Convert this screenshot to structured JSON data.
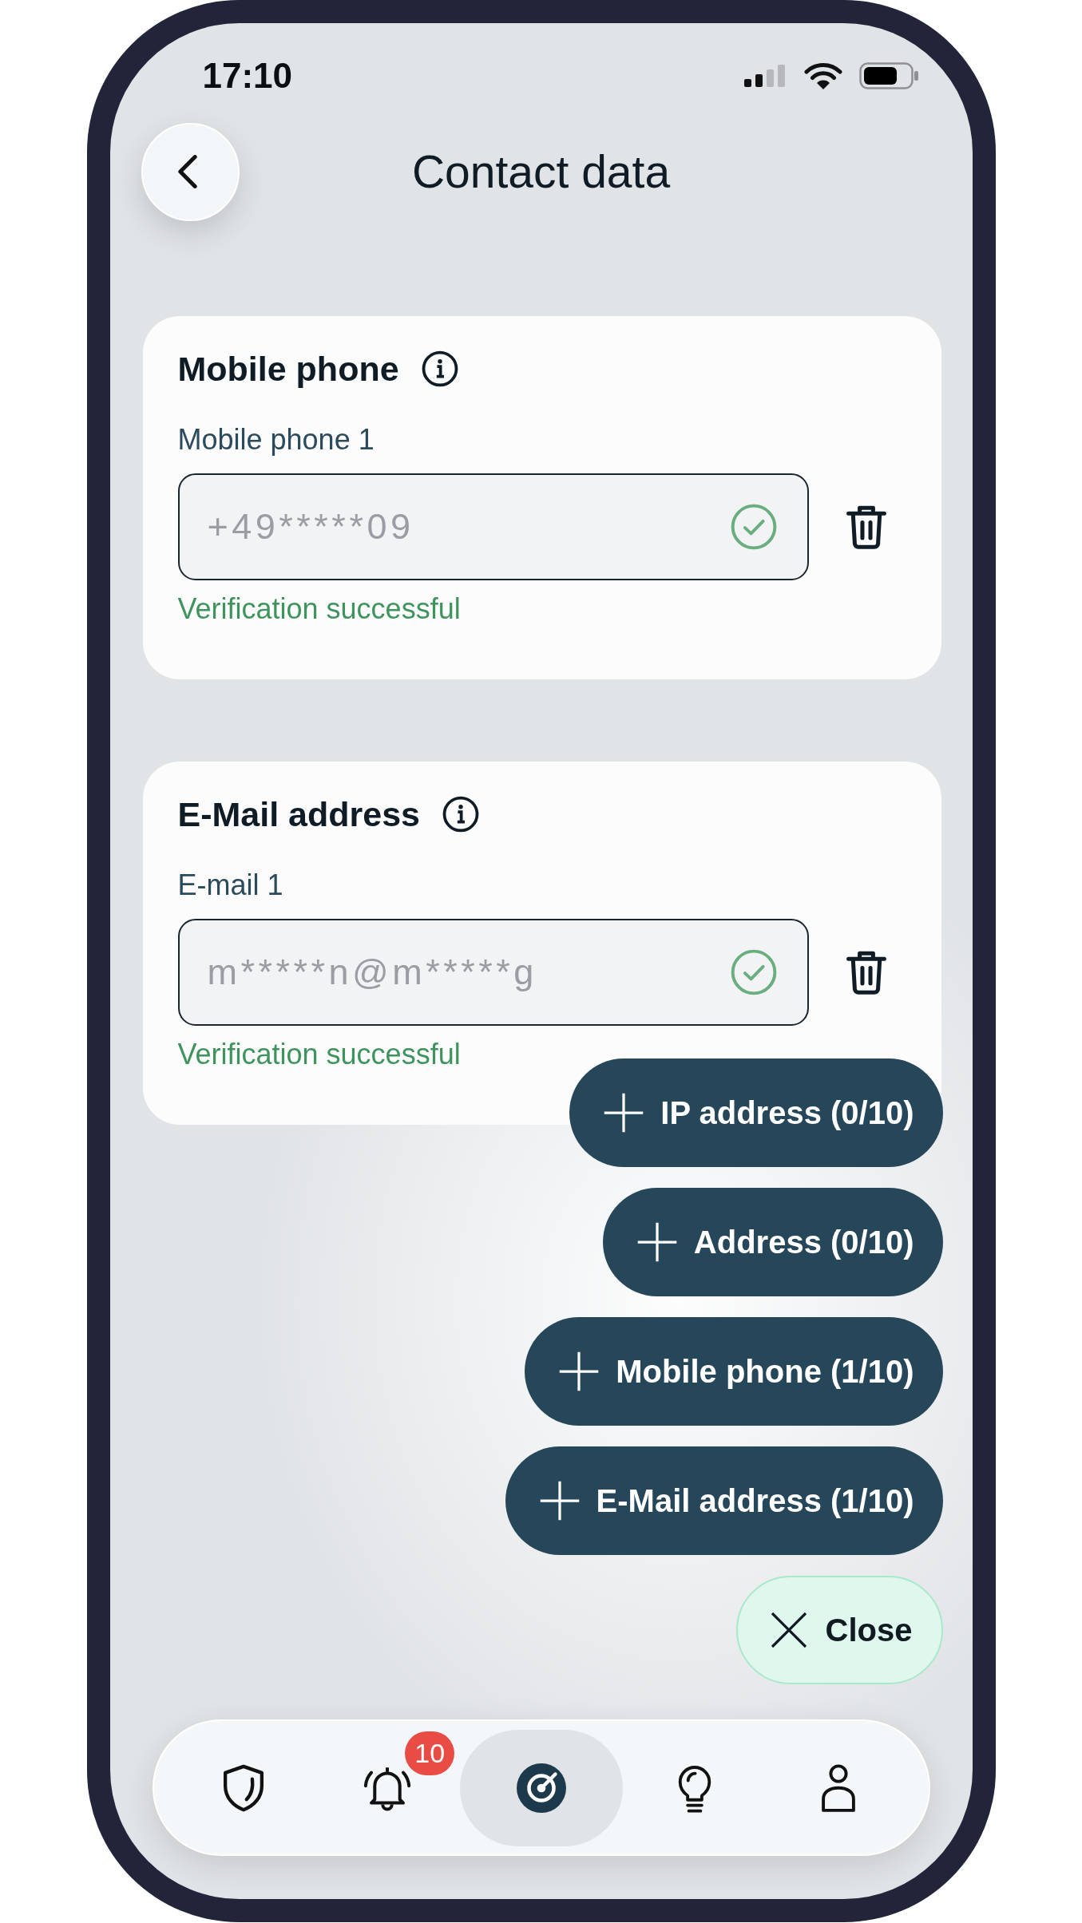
{
  "status_bar": {
    "time": "17:10"
  },
  "header": {
    "title": "Contact data"
  },
  "sections": [
    {
      "title": "Mobile phone",
      "entries": [
        {
          "label": "Mobile phone 1",
          "value": "+49*****09",
          "verified": true,
          "status": "Verification successful"
        }
      ]
    },
    {
      "title": "E-Mail address",
      "entries": [
        {
          "label": "E-mail 1",
          "value": "m*****n@m*****g",
          "verified": true,
          "status": "Verification successful"
        }
      ]
    }
  ],
  "add_menu": {
    "options": [
      "IP address (0/10)",
      "Address (0/10)",
      "Mobile phone (1/10)",
      "E-Mail address (1/10)"
    ],
    "close": "Close"
  },
  "bottom_nav": [
    {
      "selected": false
    },
    {
      "selected": false,
      "badge": "10"
    },
    {
      "selected": true
    },
    {
      "selected": false
    },
    {
      "selected": false
    }
  ]
}
